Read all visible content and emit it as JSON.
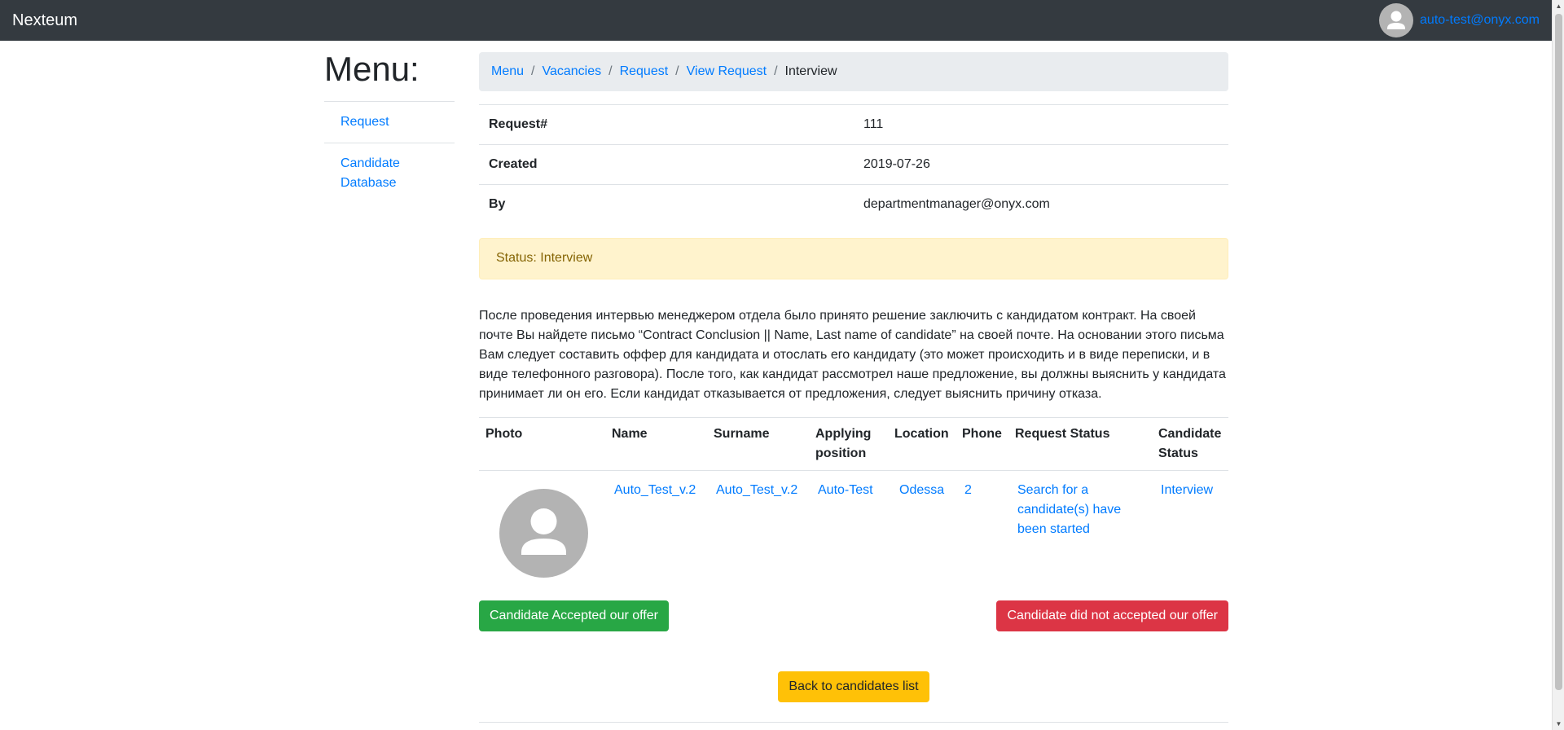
{
  "navbar": {
    "brand": "Nexteum",
    "avatar_icon": "user-avatar-icon",
    "user_email": "auto-test@onyx.com"
  },
  "sidebar": {
    "title": "Menu:",
    "items": [
      {
        "label": "Request"
      },
      {
        "label": "Candidate Database"
      }
    ]
  },
  "breadcrumb": {
    "items": [
      "Menu",
      "Vacancies",
      "Request",
      "View Request"
    ],
    "active": "Interview",
    "separator": "/"
  },
  "request_info": {
    "rows": [
      {
        "label": "Request#",
        "value": "111"
      },
      {
        "label": "Created",
        "value": "2019-07-26"
      },
      {
        "label": "By",
        "value": "departmentmanager@onyx.com"
      }
    ]
  },
  "status_alert": "Status: Interview",
  "description": "После проведения интервью менеджером отдела было принято решение заключить с кандидатом контракт. На своей почте Вы найдете письмо “Contract Conclusion || Name, Last name of candidate” на своей почте. На основании этого письма Вам следует составить оффер для кандидата и отослать его кандидату (это может происходить и в виде переписки, и в виде телефонного разговора). После того, как кандидат рассмотрел наше предложение, вы должны выяснить у кандидата принимает ли он его. Если кандидат отказывается от предложения, следует выяснить причину отказа.",
  "candidates_table": {
    "headers": [
      "Photo",
      "Name",
      "Surname",
      "Applying position",
      "Location",
      "Phone",
      "Request Status",
      "Candidate Status"
    ],
    "rows": [
      {
        "photo_icon": "user-avatar-icon",
        "name": "Auto_Test_v.2",
        "surname": "Auto_Test_v.2",
        "position": "Auto-Test",
        "location": "Odessa",
        "phone": "2",
        "request_status": "Search for a candidate(s) have been started",
        "candidate_status": "Interview"
      }
    ]
  },
  "buttons": {
    "accepted": "Candidate Accepted our offer",
    "not_accepted": "Candidate did not accepted our offer",
    "back": "Back to candidates list"
  },
  "colors": {
    "navbar": "#343a40",
    "link": "#007bff",
    "success": "#28a745",
    "danger": "#dc3545",
    "warning": "#ffc107",
    "alert_bg": "#fff3cd"
  }
}
